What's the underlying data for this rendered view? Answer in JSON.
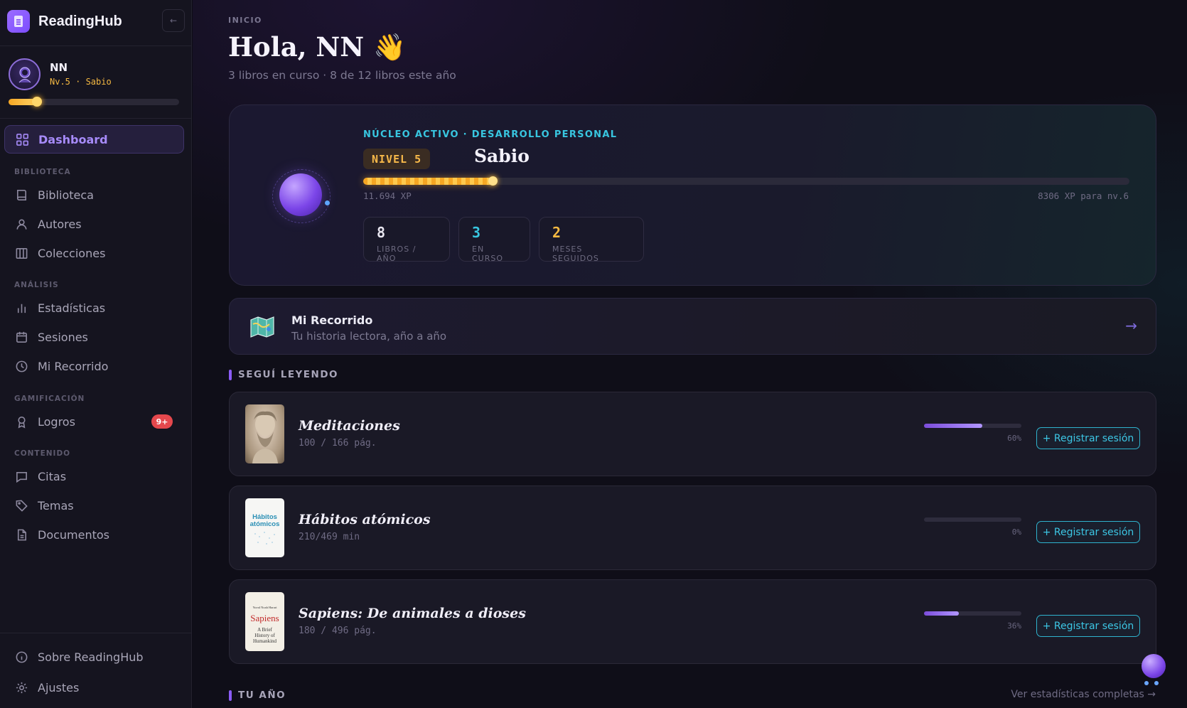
{
  "app": {
    "name": "ReadingHub",
    "collapse_label": "←"
  },
  "profile": {
    "name": "NN",
    "level_text": "Nv.5 · Sabio",
    "progress": 0.17
  },
  "nav": {
    "dashboard": "Dashboard",
    "sections": {
      "biblioteca": "BIBLIOTECA",
      "analisis": "ANÁLISIS",
      "gamificacion": "GAMIFICACIÓN",
      "contenido": "CONTENIDO"
    },
    "biblioteca": "Biblioteca",
    "autores": "Autores",
    "colecciones": "Colecciones",
    "estadisticas": "Estadísticas",
    "sesiones": "Sesiones",
    "recorrido": "Mi Recorrido",
    "logros": "Logros",
    "logros_badge": "9+",
    "citas": "Citas",
    "temas": "Temas",
    "documentos": "Documentos",
    "sobre": "Sobre ReadingHub",
    "ajustes": "Ajustes"
  },
  "page": {
    "breadcrumb": "INICIO",
    "greeting": "Hola, NN 👋",
    "subtitle": "3 libros en curso · 8 de 12 libros este año"
  },
  "hero": {
    "eyebrow": "NÚCLEO ACTIVO · DESARROLLO PERSONAL",
    "level_pill": "NIVEL 5",
    "level_name": "Sabio",
    "xp_progress": 0.17,
    "xp_current": "11.694 XP",
    "xp_next": "8306 XP para nv.6",
    "stats": [
      {
        "value": "8",
        "label": "LIBROS / AÑO",
        "color": "#e8e6f0"
      },
      {
        "value": "3",
        "label": "EN CURSO",
        "color": "#38c6e0"
      },
      {
        "value": "2",
        "label": "MESES SEGUIDOS",
        "color": "#f5b942"
      }
    ]
  },
  "journey": {
    "title": "Mi Recorrido",
    "desc": "Tu historia lectora, año a año",
    "arrow": "→"
  },
  "continue_reading": {
    "title": "SEGUÍ LEYENDO",
    "register_label": "+ Registrar sesión",
    "books": [
      {
        "title": "Meditaciones",
        "meta": "100 / 166 pág.",
        "progress": 0.6,
        "pct": "60%"
      },
      {
        "title": "Hábitos atómicos",
        "meta": "210/469 min",
        "progress": 0.0,
        "pct": "0%"
      },
      {
        "title": "Sapiens: De animales a dioses",
        "meta": "180 / 496 pág.",
        "progress": 0.36,
        "pct": "36%"
      }
    ]
  },
  "your_year": {
    "title": "TU AÑO",
    "see_all": "Ver estadísticas completas →"
  },
  "covers": {
    "habitos_lines": [
      "Hábitos",
      "atómicos"
    ],
    "sapiens_author": "Yuval Noah Harari",
    "sapiens_title": "Sapiens",
    "sapiens_sub": [
      "A Brief",
      "History of",
      "Humankind"
    ]
  }
}
